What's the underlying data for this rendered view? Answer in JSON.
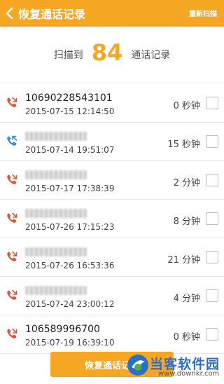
{
  "header": {
    "title": "恢复通话记录",
    "rescan_label": "重新扫描"
  },
  "summary": {
    "prefix": "扫描到",
    "count": "84",
    "suffix": "通话记录"
  },
  "records": [
    {
      "number": "10690228543101",
      "masked": false,
      "time": "2015-07-15 12:14:50",
      "duration": "0 秒钟",
      "type": "missed"
    },
    {
      "number": "",
      "masked": true,
      "time": "2015-07-14 19:51:07",
      "duration": "15 秒钟",
      "type": "outgoing"
    },
    {
      "number": "",
      "masked": true,
      "time": "2015-07-17 17:38:39",
      "duration": "2 分钟",
      "type": "missed"
    },
    {
      "number": "",
      "masked": true,
      "time": "2015-07-26 17:15:23",
      "duration": "8 分钟",
      "type": "missed"
    },
    {
      "number": "",
      "masked": true,
      "time": "2015-07-26 16:53:36",
      "duration": "21 分钟",
      "type": "missed"
    },
    {
      "number": "",
      "masked": true,
      "time": "2015-07-24 23:00:12",
      "duration": "4 分钟",
      "type": "missed"
    },
    {
      "number": "106589996700",
      "masked": false,
      "time": "2015-07-19 16:39:10",
      "duration": "0 秒钟",
      "type": "missed"
    }
  ],
  "restore_button": {
    "label": "恢复通话记录"
  },
  "watermark": {
    "name": "当客软件园",
    "url": "www.downkr.com"
  },
  "colors": {
    "accent": "#f5a623",
    "missed_icon": "#e0533a",
    "outgoing_icon": "#3a8fd9"
  }
}
